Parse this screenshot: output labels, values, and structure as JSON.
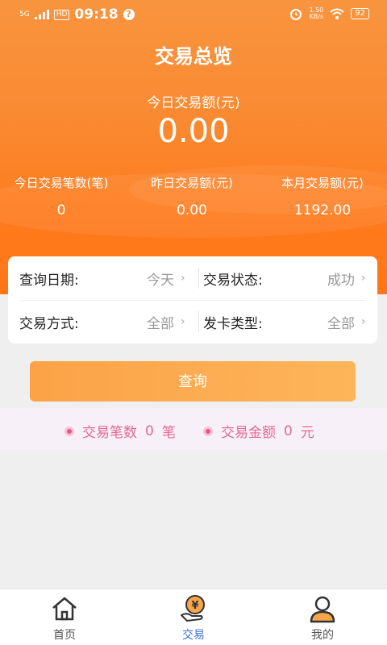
{
  "statusbar": {
    "signal": "5G",
    "hd": "HD",
    "time": "09:18",
    "help_glyph": "?",
    "speed_top": "1.50",
    "speed_unit": "KB/s",
    "battery": "92"
  },
  "header": {
    "title": "交易总览",
    "today_amount_label": "今日交易额(元)",
    "today_amount_value": "0.00"
  },
  "stats": [
    {
      "label": "今日交易笔数(笔)",
      "value": "0"
    },
    {
      "label": "昨日交易额(元)",
      "value": "0.00"
    },
    {
      "label": "本月交易额(元)",
      "value": "1192.00"
    }
  ],
  "filters": {
    "query_date": {
      "label": "查询日期:",
      "value": "今天"
    },
    "trade_status": {
      "label": "交易状态:",
      "value": "成功"
    },
    "trade_method": {
      "label": "交易方式:",
      "value": "全部"
    },
    "card_type": {
      "label": "发卡类型:",
      "value": "全部"
    },
    "chevron": "›"
  },
  "query_button": "查询",
  "summary": {
    "count_label": "交易笔数",
    "count_value": "0",
    "count_unit": "笔",
    "amount_label": "交易金额",
    "amount_value": "0",
    "amount_unit": "元"
  },
  "tabbar": {
    "items": [
      {
        "label": "首页",
        "icon": "home-icon"
      },
      {
        "label": "交易",
        "icon": "coin-hand-icon"
      },
      {
        "label": "我的",
        "icon": "user-icon"
      }
    ],
    "active_index": 1,
    "active_color": "#3a6fd8",
    "accent_color": "#f9a64a"
  }
}
